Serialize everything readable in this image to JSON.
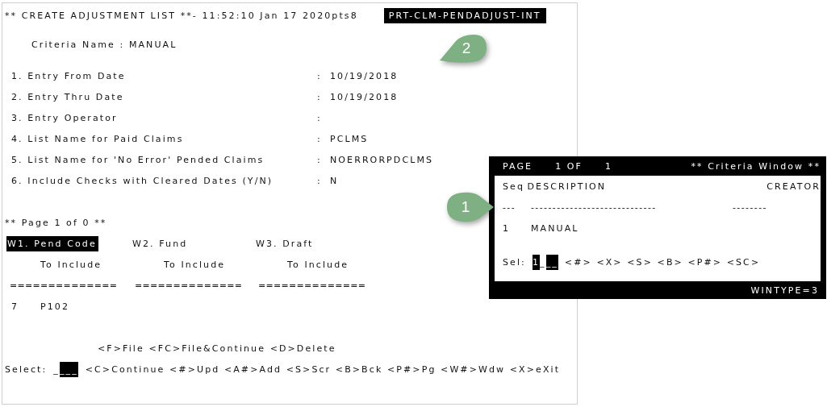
{
  "header": {
    "title": "** CREATE ADJUSTMENT LIST **- 11:52:10 Jan 17 2020pts8",
    "program_id": "PRT-CLM-PENDADJUST-INT"
  },
  "criteria": {
    "label": "Criteria Name",
    "separator": ":",
    "value": "MANUAL"
  },
  "fields": [
    {
      "label": "1. Entry From Date",
      "separator": ":",
      "value": "10/19/2018"
    },
    {
      "label": "2. Entry Thru Date",
      "separator": ":",
      "value": "10/19/2018"
    },
    {
      "label": "3. Entry Operator",
      "separator": ":"
    },
    {
      "label": "4. List Name for Paid Claims",
      "separator": ":",
      "value": "PCLMS"
    },
    {
      "label": "5. List Name for 'No Error' Pended Claims",
      "separator": ":",
      "value": "NOERRORPDCLMS"
    },
    {
      "label": "6. Include Checks with Cleared Dates (Y/N)",
      "separator": ":",
      "value": "N"
    }
  ],
  "page_info": "** Page 1 of 0 **",
  "windows": [
    {
      "label": "W1. Pend Code",
      "sublabel": "To Include",
      "rule": "==============",
      "selected": true
    },
    {
      "label": "W2. Fund",
      "sublabel": "To Include",
      "rule": "==============",
      "selected": false
    },
    {
      "label": "W3. Draft",
      "sublabel": "To Include",
      "rule": "==============",
      "selected": false
    }
  ],
  "rows": [
    {
      "seq": "7",
      "code": "P102"
    }
  ],
  "options_line": "<F>File <FC>File&Continue <D>Delete",
  "select": {
    "label": "Select:",
    "value": [
      {
        "text": "_",
        "highlight": false
      },
      {
        "text": "___",
        "highlight": true
      }
    ],
    "commands": "<C>Continue <#>Upd <A#>Add <S>Scr <B>Bck <P#>Pg <W#>Wdw <X>eXit"
  },
  "criteria_window": {
    "page": "PAGE",
    "page_num": "1 OF",
    "page_total": "1",
    "title": "** Criteria Window **",
    "columns": [
      "Seq",
      "DESCRIPTION",
      "CREATOR"
    ],
    "dashes": [
      "---",
      "-----------------------------",
      "--------"
    ],
    "rows": [
      {
        "seq": "1",
        "description": "MANUAL"
      }
    ],
    "sel_label": "Sel:",
    "sel_value": [
      {
        "text": "1",
        "highlight": true
      },
      {
        "text": "_",
        "highlight": false
      },
      {
        "text": "__",
        "highlight": true
      }
    ],
    "commands": "<#> <X> <S> <B> <P#> <SC>",
    "footer": "WINTYPE=3"
  },
  "callouts": [
    {
      "number": "2"
    },
    {
      "number": "1"
    }
  ]
}
